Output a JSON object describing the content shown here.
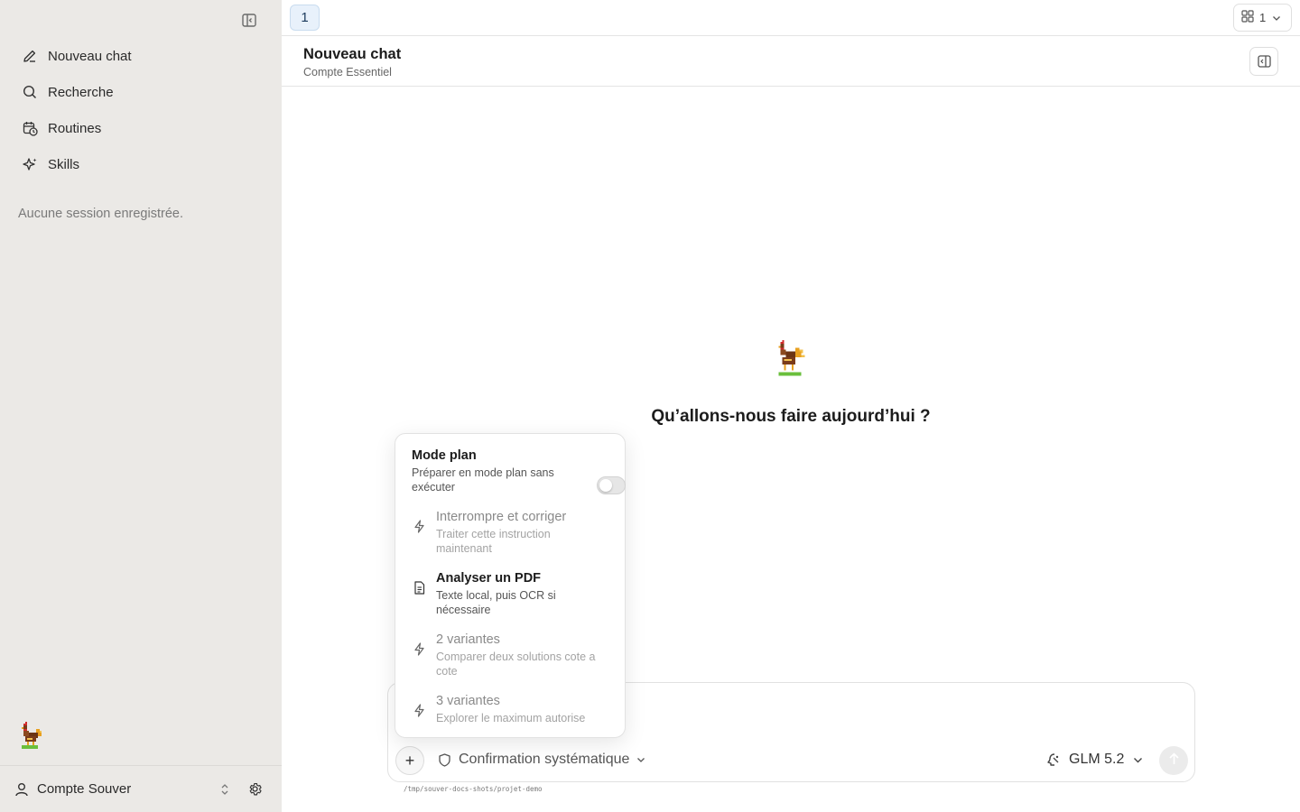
{
  "sidebar": {
    "items": [
      {
        "label": "Nouveau chat",
        "icon": "pencil-icon"
      },
      {
        "label": "Recherche",
        "icon": "search-icon"
      },
      {
        "label": "Routines",
        "icon": "calendar-clock-icon"
      },
      {
        "label": "Skills",
        "icon": "sparkle-icon"
      }
    ],
    "empty_sessions": "Aucune session enregistrée.",
    "account_name": "Compte Souver"
  },
  "tabs": {
    "active_tab": "1",
    "layout_count": "1"
  },
  "header": {
    "title": "Nouveau chat",
    "subtitle": "Compte Essentiel"
  },
  "hero": {
    "greeting": "Qu’allons-nous faire aujourd’hui ?"
  },
  "popup": {
    "plan": {
      "title": "Mode plan",
      "desc": "Préparer en mode plan sans exécuter",
      "enabled": false
    },
    "items": [
      {
        "title": "Interrompre et corriger",
        "desc": "Traiter cette instruction maintenant",
        "icon": "lightning-icon",
        "disabled": true
      },
      {
        "title": "Analyser un PDF",
        "desc": "Texte local, puis OCR si nécessaire",
        "icon": "document-icon",
        "disabled": false
      },
      {
        "title": "2 variantes",
        "desc": "Comparer deux solutions cote a cote",
        "icon": "lightning-icon",
        "disabled": true
      },
      {
        "title": "3 variantes",
        "desc": "Explorer le maximum autorise",
        "icon": "lightning-icon",
        "disabled": true
      }
    ]
  },
  "composer": {
    "confirmation_mode": "Confirmation systématique",
    "model": "GLM 5.2",
    "cwd": "/tmp/souver-docs-shots/projet-demo"
  },
  "colors": {
    "sidebar_bg": "#ebe9e6",
    "tab_active_bg": "#e8f1fb",
    "accent": "#1b3a5c"
  }
}
